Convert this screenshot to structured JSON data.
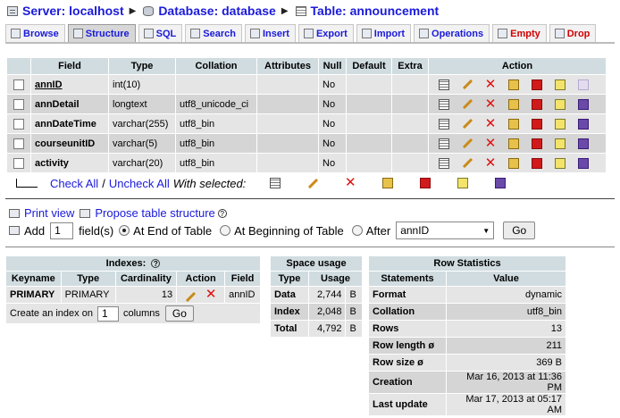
{
  "breadcrumb": {
    "server": "Server: localhost",
    "database": "Database: database",
    "table": "Table: announcement"
  },
  "tabs": [
    {
      "label": "Browse",
      "icon": "browse-icon"
    },
    {
      "label": "Structure",
      "icon": "structure-icon"
    },
    {
      "label": "SQL",
      "icon": "sql-icon"
    },
    {
      "label": "Search",
      "icon": "search-icon"
    },
    {
      "label": "Insert",
      "icon": "insert-icon"
    },
    {
      "label": "Export",
      "icon": "export-icon"
    },
    {
      "label": "Import",
      "icon": "import-icon"
    },
    {
      "label": "Operations",
      "icon": "operations-icon"
    },
    {
      "label": "Empty",
      "icon": "empty-icon"
    },
    {
      "label": "Drop",
      "icon": "drop-icon"
    }
  ],
  "structure": {
    "headers": [
      "Field",
      "Type",
      "Collation",
      "Attributes",
      "Null",
      "Default",
      "Extra",
      "Action"
    ],
    "rows": [
      {
        "field": "annID",
        "type": "int(10)",
        "collation": "",
        "attributes": "",
        "null": "No",
        "default": "",
        "extra": ""
      },
      {
        "field": "annDetail",
        "type": "longtext",
        "collation": "utf8_unicode_ci",
        "attributes": "",
        "null": "No",
        "default": "",
        "extra": ""
      },
      {
        "field": "annDateTime",
        "type": "varchar(255)",
        "collation": "utf8_bin",
        "attributes": "",
        "null": "No",
        "default": "",
        "extra": ""
      },
      {
        "field": "courseunitID",
        "type": "varchar(5)",
        "collation": "utf8_bin",
        "attributes": "",
        "null": "No",
        "default": "",
        "extra": ""
      },
      {
        "field": "activity",
        "type": "varchar(20)",
        "collation": "utf8_bin",
        "attributes": "",
        "null": "No",
        "default": "",
        "extra": ""
      }
    ]
  },
  "with_selected": {
    "check_all": "Check All",
    "separator": "/",
    "uncheck_all": "Uncheck All",
    "label": "With selected:"
  },
  "links": {
    "print_view": "Print view",
    "propose": "Propose table structure"
  },
  "add": {
    "label": "Add",
    "count": "1",
    "fields_label": "field(s)",
    "end_label": "At End of Table",
    "beginning_label": "At Beginning of Table",
    "after_label": "After",
    "after_value": "annID",
    "go": "Go"
  },
  "indexes": {
    "title": "Indexes:",
    "headers": [
      "Keyname",
      "Type",
      "Cardinality",
      "Action",
      "Field"
    ],
    "rows": [
      {
        "keyname": "PRIMARY",
        "type": "PRIMARY",
        "cardinality": "13",
        "field": "annID"
      }
    ],
    "create_label_a": "Create an index on",
    "create_count": "1",
    "create_label_b": "columns",
    "go": "Go"
  },
  "space_usage": {
    "title": "Space usage",
    "headers": [
      "Type",
      "Usage"
    ],
    "rows": [
      {
        "type": "Data",
        "value": "2,744",
        "unit": "B"
      },
      {
        "type": "Index",
        "value": "2,048",
        "unit": "B"
      },
      {
        "type": "Total",
        "value": "4,792",
        "unit": "B"
      }
    ]
  },
  "row_stats": {
    "title": "Row Statistics",
    "headers": [
      "Statements",
      "Value"
    ],
    "rows": [
      {
        "statement": "Format",
        "value": "dynamic"
      },
      {
        "statement": "Collation",
        "value": "utf8_bin"
      },
      {
        "statement": "Rows",
        "value": "13"
      },
      {
        "statement": "Row length ø",
        "value": "211"
      },
      {
        "statement": "Row size ø",
        "value": "369 B"
      },
      {
        "statement": "Creation",
        "value": "Mar 16, 2013 at 11:36 PM"
      },
      {
        "statement": "Last update",
        "value": "Mar 17, 2013 at 05:17 AM"
      }
    ]
  },
  "colors": {
    "link": "#1a1adb",
    "header_bg": "#d0dce0",
    "row_light": "#e5e5e5",
    "row_dark": "#d5d5d5",
    "danger": "#d10000"
  }
}
